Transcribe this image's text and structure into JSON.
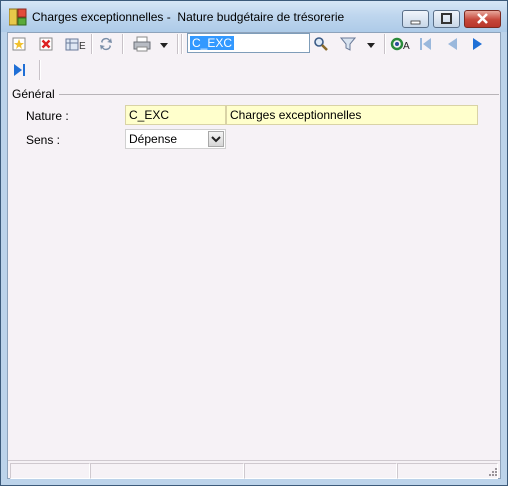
{
  "window": {
    "title": "Charges exceptionnelles -  Nature budgétaire de trésorerie",
    "icons": [
      "app-icon",
      "minimize-icon",
      "maximize-icon",
      "close-icon"
    ]
  },
  "toolbar": {
    "search_value": "C_EXC",
    "buttons": [
      "new-icon",
      "delete-icon",
      "export-icon",
      "refresh-icon",
      "print-icon",
      "print-dropdown-icon",
      "search-icon",
      "filter-icon",
      "filter-dropdown-icon",
      "refresh-all-icon",
      "first-icon",
      "previous-icon",
      "next-icon",
      "last-icon"
    ]
  },
  "form": {
    "group_title": "Général",
    "nature_label": "Nature :",
    "nature_code": "C_EXC",
    "nature_name": "Charges exceptionnelles",
    "sens_label": "Sens :",
    "sens_value": "Dépense"
  },
  "status": {
    "cells": [
      "",
      "",
      "",
      ""
    ]
  }
}
